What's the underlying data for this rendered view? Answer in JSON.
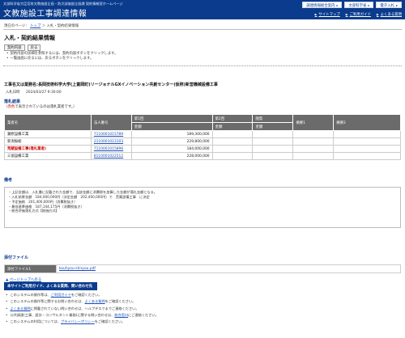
{
  "header": {
    "org": "文部科学省大臣官房文教施設企画・防災部施設企画課 契約情報室ホームページ",
    "title": "文教施設工事調達情報",
    "ext_buttons": [
      {
        "label": "調達情報総合案内"
      },
      {
        "label": "文部科学省"
      },
      {
        "label": "電子入札"
      }
    ],
    "sub_links": [
      {
        "label": "サイトマップ"
      },
      {
        "label": "ご利用ガイド"
      },
      {
        "label": "よくある質問"
      }
    ]
  },
  "breadcrumb": {
    "prefix": "現在のページ：",
    "top": "トップ",
    "sep": "＞",
    "current": "入札・契約結果情報"
  },
  "page": {
    "heading": "入札・契約結果情報",
    "buttons": {
      "contract": "契約内容",
      "back": "戻る"
    },
    "help": [
      "契約内容の詳細を参照するには、契約内容ボタンをクリックします。",
      "一覧画面に戻るには、戻るボタンをクリックします。"
    ]
  },
  "project": {
    "title": "工事名又は業務名:長岡技術科学大学(上富岡町)リージョナルGXイノベーション共創センター(仮称)新営機械設備工事",
    "datetime_label": "入札日時",
    "datetime_value": "2024/03/27 9:30:00"
  },
  "results": {
    "section_label": "落札結果",
    "note_pre": "（",
    "note_red": "赤色",
    "note_post": "で表示されているのは落札業者です。）",
    "headers": {
      "company": "業者名",
      "corp": "法人番号",
      "round1": "第1回",
      "round2": "第2回",
      "round3": "随契",
      "remark1": "摘要1",
      "remark2": "摘要2",
      "amount": "金額"
    },
    "rows": [
      {
        "company": "瀬原設備工業",
        "corp": "7110001015789",
        "amount": "189,300,000",
        "winner": false
      },
      {
        "company": "新潟振総",
        "corp": "2110001023103",
        "amount": "229,800,000",
        "winner": false
      },
      {
        "company": "荒蔵設備工事(落札業者)",
        "corp": "7110001015896",
        "amount": "184,000,000",
        "winner": true
      },
      {
        "company": "三協設備工業",
        "corp": "8110001022512",
        "amount": "228,000,000",
        "winner": false
      }
    ]
  },
  "notes": {
    "section_label": "備考",
    "lines": [
      "・上記金額は、入札書に記載された金額で、当該金額に消費税を加算した金額が落札金額となる。",
      "・入札結果金額　184,000,000円（決定金額　202,400,000円）で　荒蔵設備工事　に決定",
      "・予定価格　201,400,000円（消費税抜き）",
      "・最低基準価格　187,144,175円（消費税抜き）",
      "・総合評価落札方式【総価方式】"
    ]
  },
  "attachments": {
    "section_label": "添付ファイル",
    "label": "添付ファイル1",
    "file": "kouhyou-shiryou.pdf"
  },
  "page_top_link": "ページトップへ戻る",
  "guide": {
    "title": "本サイトご利用ガイド、よくある質問、問い合わせ先",
    "items": [
      {
        "pre": "このシステムの操作等は、",
        "link": "ご利用ガイド",
        "post": "をご確認ください。"
      },
      {
        "pre": "このシステムの操作等に関するお問い合わせは、",
        "link": "よくある質問",
        "post": "をご確認ください。"
      },
      {
        "pre": "",
        "link": "よくある質問",
        "post": "に掲載されていない問い合わせは、ヘルプデスクまでご連絡ください。"
      },
      {
        "pre": "公共調達(工事、設計・コンサルタント業務)に関する問い合わせは、",
        "link": "総合窓口",
        "post": "にご連絡ください。"
      },
      {
        "pre": "このシステムの利用については、",
        "link": "プライバシーポリシー",
        "post": "をご確認ください。"
      }
    ]
  },
  "colors": {
    "header_bg": "#0a3b8c",
    "table_header_bg": "#6b6b6b",
    "winner_text": "#d00000",
    "link": "#1a4fb8"
  }
}
